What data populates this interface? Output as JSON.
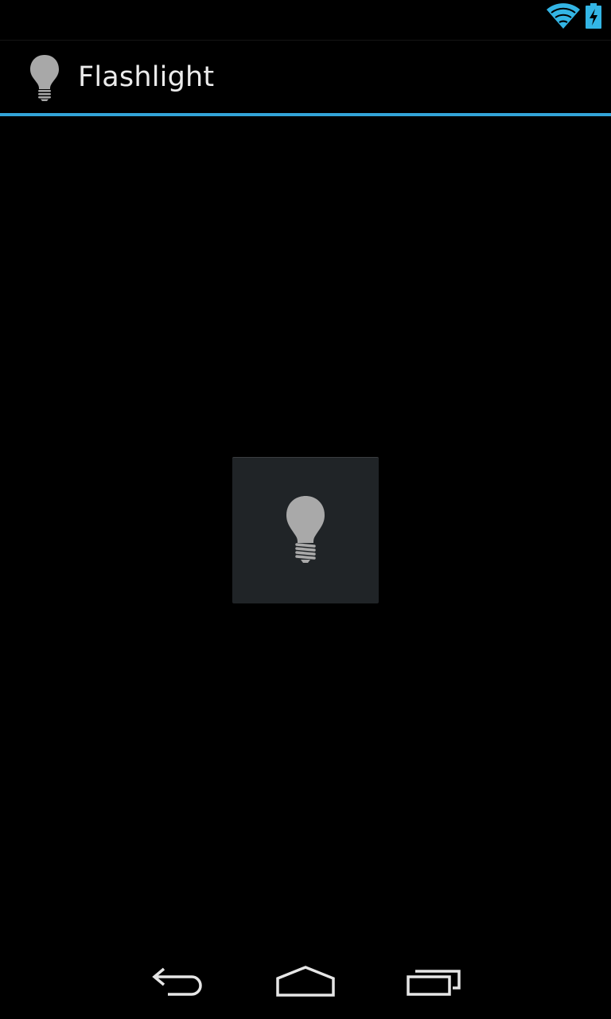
{
  "status_bar": {
    "icons": [
      "wifi-icon",
      "battery-charging-icon"
    ],
    "accent_color": "#33b5e5"
  },
  "action_bar": {
    "title": "Flashlight",
    "icon": "lightbulb-icon",
    "underline_color": "#33a4d8"
  },
  "main": {
    "toggle_icon": "lightbulb-icon",
    "toggle_background": "#202427"
  },
  "nav_bar": {
    "buttons": [
      "back-icon",
      "home-icon",
      "recent-apps-icon"
    ]
  }
}
